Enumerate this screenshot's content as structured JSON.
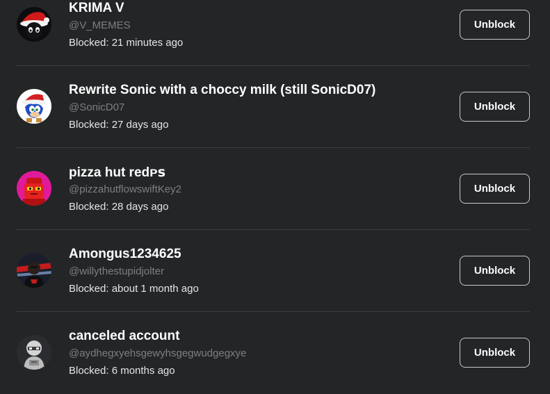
{
  "blocked_users": [
    {
      "display_name": "KRIMA V",
      "username": "@V_MEMES",
      "blocked_time": "Blocked: 21 minutes ago",
      "button_label": "Unblock",
      "avatar": "avatar-santa-hat-dark"
    },
    {
      "display_name": "Rewrite Sonic with a choccy milk (still SonicD07)",
      "username": "@SonicD07",
      "blocked_time": "Blocked: 27 days ago",
      "button_label": "Unblock",
      "avatar": "avatar-sonic-santa"
    },
    {
      "display_name": "pizza hut redᴘꜱ",
      "username": "@pizzahutflowswiftKey2",
      "blocked_time": "Blocked: 28 days ago",
      "button_label": "Unblock",
      "avatar": "avatar-red-character"
    },
    {
      "display_name": "Amongus1234625",
      "username": "@willythestupidjolter",
      "blocked_time": "Blocked: about 1 month ago",
      "button_label": "Unblock",
      "avatar": "avatar-dark-person"
    },
    {
      "display_name": "canceled account",
      "username": "@aydhegxyehsgewyhsgegwudgegxye",
      "blocked_time": "Blocked: 6 months ago",
      "button_label": "Unblock",
      "avatar": "avatar-gray-robot"
    }
  ]
}
